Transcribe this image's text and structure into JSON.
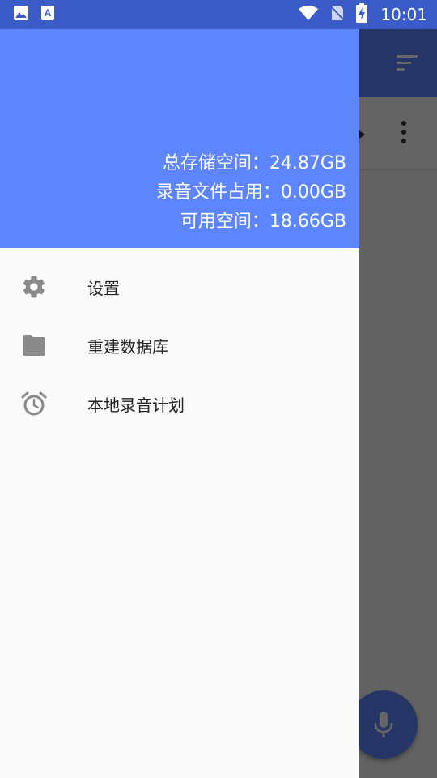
{
  "status_bar": {
    "time": "10:01",
    "icons": [
      "image-icon",
      "keyboard-a-icon",
      "wifi-icon",
      "no-sim-icon",
      "battery-charging-icon"
    ]
  },
  "drawer": {
    "storage": {
      "total": "总存储空间：24.87GB",
      "recordings": "录音文件占用：0.00GB",
      "available": "可用空间：18.66GB"
    },
    "menu": [
      {
        "label": "设置",
        "icon": "gear-icon"
      },
      {
        "label": "重建数据库",
        "icon": "folder-icon"
      },
      {
        "label": "本地录音计划",
        "icon": "alarm-clock-icon"
      }
    ]
  },
  "background_app": {
    "icons": [
      "sort-icon",
      "more-vert-icon",
      "play-arrow-icon",
      "mic-icon"
    ]
  },
  "colors": {
    "accent": "#5c85ff",
    "status_bar": "#3b5bc9",
    "drawer_bg": "#fafafa",
    "icon_gray": "#8a8a8a"
  }
}
